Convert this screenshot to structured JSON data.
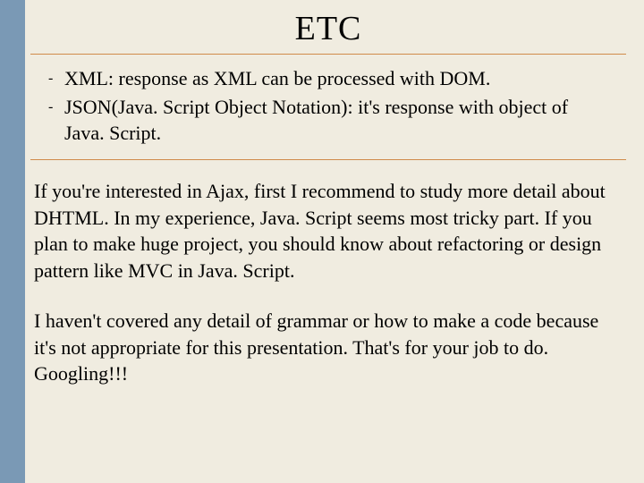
{
  "title": "ETC",
  "bullets": {
    "items": [
      {
        "text": "XML: response as XML can be processed with DOM."
      },
      {
        "text": "JSON(Java. Script Object Notation): it's response with object of Java. Script."
      }
    ]
  },
  "paragraphs": {
    "p1": "If you're interested in Ajax, first I recommend to study more detail about DHTML. In my experience, Java. Script seems most tricky part. If you plan to make huge project, you should know about refactoring or design pattern like MVC in Java. Script.",
    "p2": "I haven't covered any detail of grammar or how to make a code because it's not appropriate for this presentation. That's for your job to do. Googling!!!"
  }
}
